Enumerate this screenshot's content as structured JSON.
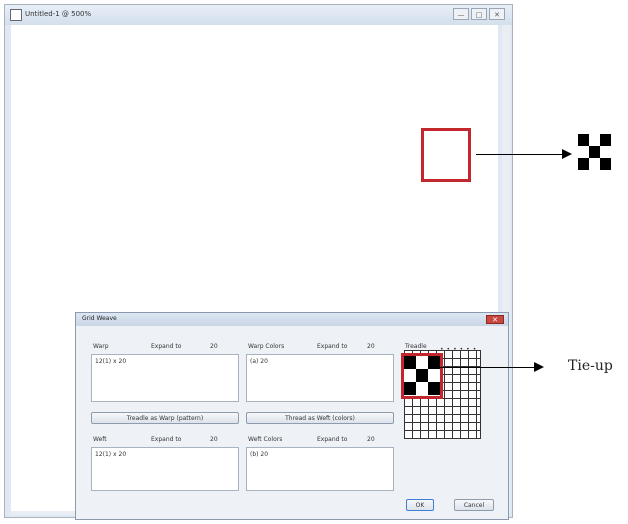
{
  "window": {
    "title": "Untitled-1 @ 500%",
    "controls": [
      "—",
      "□",
      "✕"
    ]
  },
  "dialog": {
    "title": "Grid Weave",
    "close": "✕",
    "fields": {
      "warp": {
        "label": "Warp",
        "extra": "Expand to",
        "num": "20",
        "value": "12(1) x 20"
      },
      "warp_colors": {
        "label": "Warp Colors",
        "extra": "Expand to",
        "num": "20",
        "value": "(a) 20"
      },
      "weft": {
        "label": "Weft",
        "extra": "Expand to",
        "num": "20",
        "value": "12(1) x 20"
      },
      "weft_colors": {
        "label": "Weft Colors",
        "extra": "Expand to",
        "num": "20",
        "value": "(b) 20"
      }
    },
    "buttons": {
      "treadle": "Treadle as Warp (pattern)",
      "thread": "Thread as Weft (colors)",
      "ok": "OK",
      "cancel": "Cancel"
    },
    "treadle_label": "Treadle"
  },
  "callout": {
    "text": "Tie-up"
  },
  "colors": {
    "accent": "#c1272d"
  }
}
